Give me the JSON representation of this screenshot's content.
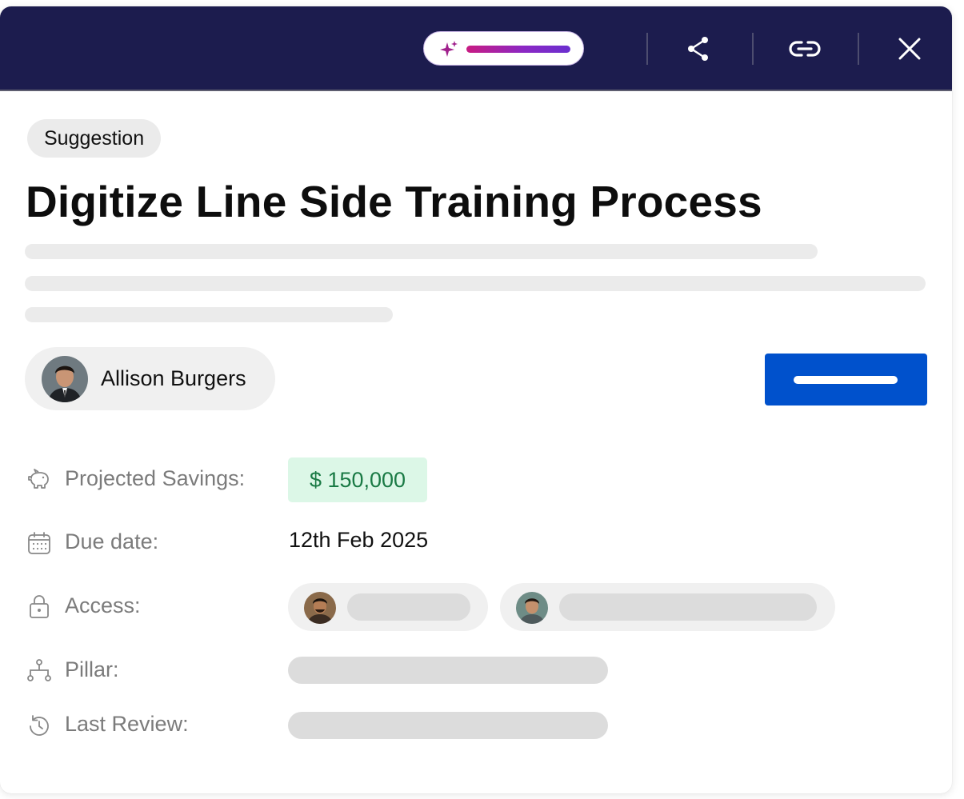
{
  "header": {
    "icons": [
      "ai-sparkle-icon",
      "share-icon",
      "link-icon",
      "close-icon"
    ],
    "bg_color": "#1c1c4e"
  },
  "tag": "Suggestion",
  "title": "Digitize Line Side Training Process",
  "owner": {
    "name": "Allison Burgers",
    "avatar": "avatar"
  },
  "primary_action": {
    "color": "#0051cc"
  },
  "fields": {
    "projected_savings": {
      "label": "Projected Savings:",
      "value": "$ 150,000",
      "icon": "piggy-bank-icon"
    },
    "due_date": {
      "label": "Due date:",
      "value": "12th Feb 2025",
      "icon": "calendar-icon"
    },
    "access": {
      "label": "Access:",
      "icon": "lock-icon"
    },
    "pillar": {
      "label": "Pillar:",
      "icon": "hierarchy-icon"
    },
    "last_review": {
      "label": "Last Review:",
      "icon": "history-icon"
    }
  },
  "colors": {
    "accent": "#0051cc",
    "savings_bg": "#dcf7e7",
    "savings_text": "#1a7a45"
  }
}
